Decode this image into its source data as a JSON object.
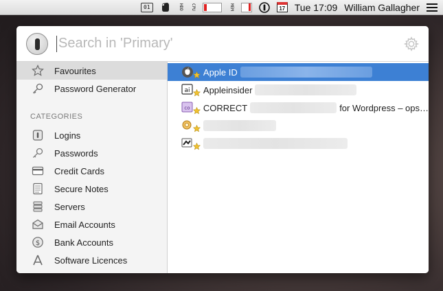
{
  "menubar": {
    "clock": "Tue 17:09",
    "user": "William Gallagher",
    "calendar_day": "17",
    "hdd_label": "HDD",
    "cpu_label": "CPU",
    "mem_label": "MEM",
    "icons": [
      "status-app-icon",
      "evernote-icon",
      "hdd-monitor-icon",
      "cpu-monitor-icon",
      "mem-monitor-icon",
      "onepassword-icon",
      "calendar-icon",
      "list-menu-icon"
    ]
  },
  "search": {
    "placeholder": "Search in 'Primary'"
  },
  "sidebar": {
    "top_items": [
      {
        "label": "Favourites",
        "icon": "star-icon",
        "selected": true
      },
      {
        "label": "Password Generator",
        "icon": "key-icon",
        "selected": false
      }
    ],
    "categories_header": "CATEGORIES",
    "categories": [
      {
        "label": "Logins",
        "icon": "logins-icon"
      },
      {
        "label": "Passwords",
        "icon": "password-key-icon"
      },
      {
        "label": "Credit Cards",
        "icon": "credit-card-icon"
      },
      {
        "label": "Secure Notes",
        "icon": "secure-note-icon"
      },
      {
        "label": "Servers",
        "icon": "server-icon"
      },
      {
        "label": "Email Accounts",
        "icon": "email-icon"
      },
      {
        "label": "Bank Accounts",
        "icon": "bank-icon"
      },
      {
        "label": "Software Licences",
        "icon": "software-licence-icon"
      }
    ]
  },
  "results": [
    {
      "title": "Apple ID",
      "suffix": "",
      "icon": "apple-logo-icon",
      "selected": true
    },
    {
      "title": "Appleinsider",
      "suffix": "",
      "icon": "appleinsider-icon",
      "selected": false
    },
    {
      "title": "CORRECT",
      "suffix": "for Wordpress – ops…",
      "icon": "login-co-icon",
      "selected": false
    },
    {
      "title": "",
      "suffix": "",
      "icon": "key-ring-icon",
      "selected": false
    },
    {
      "title": "",
      "suffix": "",
      "icon": "software-icon",
      "selected": false
    }
  ],
  "colors": {
    "selection_blue": "#3d80d4",
    "sidebar_bg": "#f4f4f4",
    "favourite_star": "#f2c230"
  }
}
